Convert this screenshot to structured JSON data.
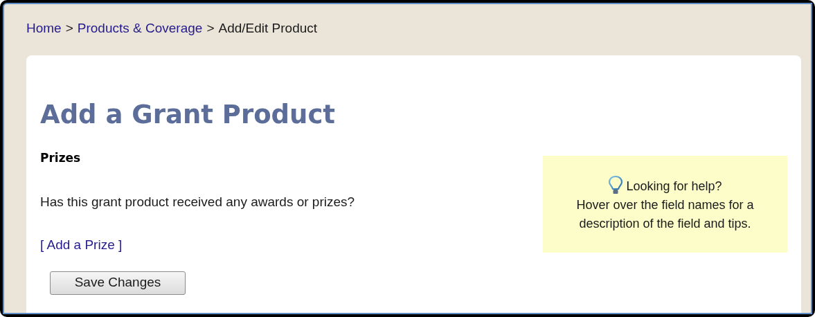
{
  "breadcrumb": {
    "separator": ">",
    "items": [
      {
        "label": "Home",
        "kind": "link"
      },
      {
        "label": "Products & Coverage",
        "kind": "link"
      },
      {
        "label": "Add/Edit Product",
        "kind": "current"
      }
    ]
  },
  "page_title": "Add a Grant Product",
  "section_heading": "Prizes",
  "question": "Has this grant product received any awards or prizes?",
  "add_link": "[ Add a Prize ]",
  "help": {
    "title": "Looking for help?",
    "text": "Hover over the field names for a description of the field and tips."
  },
  "buttons": [
    {
      "label": "Save Changes"
    }
  ]
}
